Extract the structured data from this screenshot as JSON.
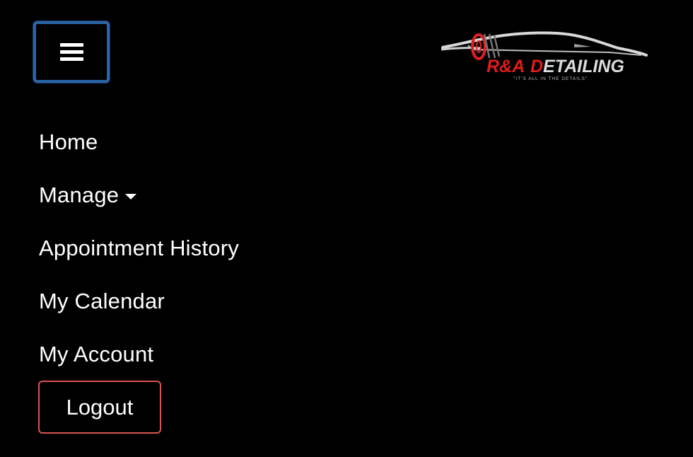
{
  "navbar": {
    "toggler_icon": "hamburger-icon",
    "accent_color": "#2a64a8",
    "brand": {
      "name_red": "R&A ",
      "name_red_letter": "D",
      "name_white": "ETAILING",
      "tagline": "\"IT'S ALL IN THE DETAILS\"",
      "logo_icon": "car-silhouette-icon"
    },
    "menu": [
      {
        "label": "Home"
      },
      {
        "label": "Manage",
        "has_dropdown": true,
        "dropdown_icon": "caret-down-icon"
      },
      {
        "label": "Appointment History"
      },
      {
        "label": "My Calendar"
      },
      {
        "label": "My Account"
      }
    ],
    "logout": {
      "label": "Logout",
      "border_color": "#d9534f"
    }
  }
}
